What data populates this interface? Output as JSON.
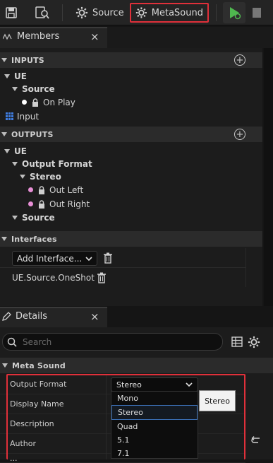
{
  "toolbar": {
    "source_label": "Source",
    "metasound_label": "MetaSound",
    "highlight_color": "#e0303a",
    "play_color": "#4fb84f"
  },
  "members": {
    "tab_label": "Members",
    "close_glyph": "×",
    "inputs_label": "INPUTS",
    "inputs_tree": {
      "ue": "UE",
      "source": "Source",
      "on_play": "On Play",
      "input": "Input"
    },
    "outputs_label": "OUTPUTS",
    "outputs_tree": {
      "ue": "UE",
      "output_format": "Output Format",
      "stereo": "Stereo",
      "out_left": "Out Left",
      "out_right": "Out Right",
      "source": "Source"
    },
    "interfaces_label": "Interfaces",
    "add_interface_label": "Add Interface...",
    "interface_item": "UE.Source.OneShot"
  },
  "details": {
    "tab_label": "Details",
    "close_glyph": "×",
    "search_placeholder": "Search",
    "section_label": "Meta Sound",
    "props": [
      {
        "label": "Output Format"
      },
      {
        "label": "Display Name"
      },
      {
        "label": "Description"
      },
      {
        "label": "Author"
      },
      {
        "label": "..."
      }
    ],
    "output_format_value": "Stereo",
    "dropdown_options": [
      "Mono",
      "Stereo",
      "Quad",
      "5.1",
      "7.1"
    ],
    "selected_option": "Stereo",
    "tooltip": "Stereo"
  },
  "colors": {
    "pin_pink": "#e88fd6",
    "pin_white": "#ffffff",
    "input_blue": "#3f7de0",
    "selection_blue": "#3b6fb6"
  }
}
